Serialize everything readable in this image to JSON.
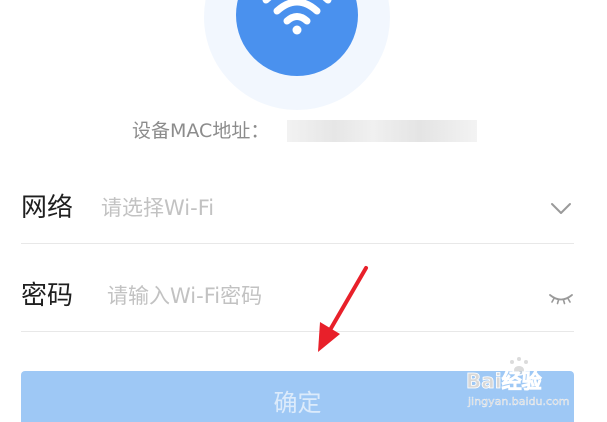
{
  "device": {
    "mac_label": "设备MAC地址：",
    "mac_value": ""
  },
  "form": {
    "network": {
      "label": "网络",
      "placeholder": "请选择Wi-Fi",
      "value": "",
      "icon": "chevron-down-icon"
    },
    "password": {
      "label": "密码",
      "placeholder": "请输入Wi-Fi密码",
      "value": "",
      "icon": "eye-closed-icon"
    }
  },
  "confirm_button": {
    "label": "确定"
  },
  "watermark": {
    "brand": "Bai经验",
    "url": "jingyan.baidu.com"
  },
  "colors": {
    "accent": "#4a91ee",
    "button_disabled": "#9ec8f5",
    "annotation": "#e8202a"
  }
}
